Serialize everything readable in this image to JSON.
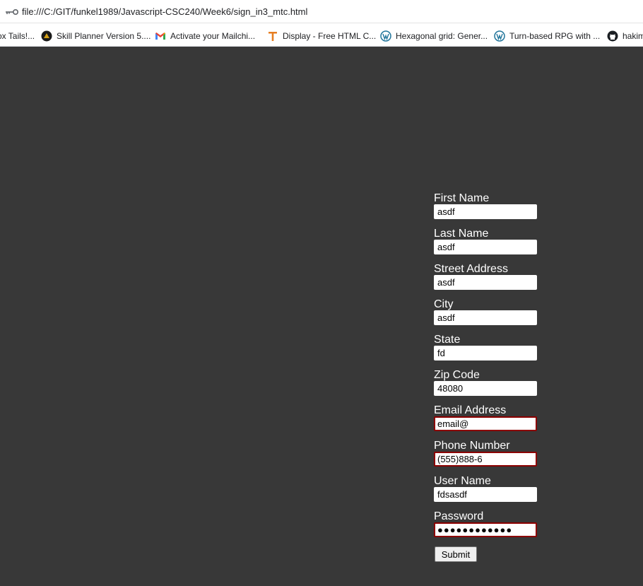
{
  "browser": {
    "url": "file:///C:/GIT/funkel1989/Javascript-CSC240/Week6/sign_in3_mtc.html",
    "bookmarks": [
      {
        "label": "ox Tails!...",
        "icon": "none"
      },
      {
        "label": "Skill Planner Version 5....",
        "icon": "skill-planner-icon"
      },
      {
        "label": "Activate your Mailchi...",
        "icon": "gmail-icon"
      },
      {
        "label": "Display - Free HTML C...",
        "icon": "t-icon"
      },
      {
        "label": "Hexagonal grid: Gener...",
        "icon": "wordpress-icon"
      },
      {
        "label": "Turn-based RPG with ...",
        "icon": "wordpress-icon"
      },
      {
        "label": "hakim",
        "icon": "github-icon"
      }
    ]
  },
  "form": {
    "fields": [
      {
        "label": "First Name",
        "value": "asdf",
        "invalid": false
      },
      {
        "label": "Last Name",
        "value": "asdf",
        "invalid": false
      },
      {
        "label": "Street Address",
        "value": "asdf",
        "invalid": false
      },
      {
        "label": "City",
        "value": "asdf",
        "invalid": false
      },
      {
        "label": "State",
        "value": "fd",
        "invalid": false
      },
      {
        "label": "Zip Code",
        "value": "48080",
        "invalid": false
      },
      {
        "label": "Email Address",
        "value": "email@",
        "invalid": true
      },
      {
        "label": "Phone Number",
        "value": "(555)888-6",
        "invalid": true
      },
      {
        "label": "User Name",
        "value": "fdsasdf",
        "invalid": false
      },
      {
        "label": "Password",
        "value": "●●●●●●●●●●●●",
        "invalid": true
      }
    ],
    "submit_label": "Submit"
  },
  "colors": {
    "page_background": "#383838",
    "invalid_border": "#8b0000"
  }
}
